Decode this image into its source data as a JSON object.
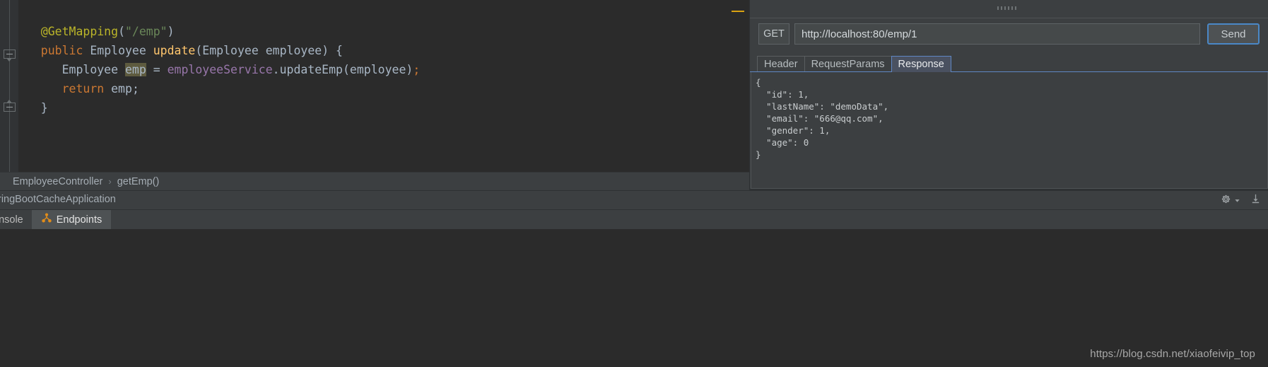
{
  "editor": {
    "code_lines": [
      {
        "indent": 3,
        "tokens": [
          {
            "t": "@GetMapping",
            "c": "tok-ann"
          },
          {
            "t": "(",
            "c": "tok-punct"
          },
          {
            "t": "\"/emp\"",
            "c": "tok-str"
          },
          {
            "t": ")",
            "c": "tok-punct"
          }
        ]
      },
      {
        "indent": 3,
        "tokens": [
          {
            "t": "public",
            "c": "tok-kw"
          },
          {
            "t": " ",
            "c": "tok-punct"
          },
          {
            "t": "Employee",
            "c": "tok-type"
          },
          {
            "t": " ",
            "c": "tok-punct"
          },
          {
            "t": "update",
            "c": "tok-meth"
          },
          {
            "t": "(",
            "c": "tok-punct"
          },
          {
            "t": "Employee",
            "c": "tok-type"
          },
          {
            "t": " employee",
            "c": "tok-ident"
          },
          {
            "t": ") {",
            "c": "tok-punct"
          }
        ]
      },
      {
        "indent": 6,
        "tokens": [
          {
            "t": "Employee",
            "c": "tok-type"
          },
          {
            "t": " ",
            "c": "tok-punct"
          },
          {
            "t": "emp",
            "c": "tok-hl"
          },
          {
            "t": " = ",
            "c": "tok-punct"
          },
          {
            "t": "employeeService",
            "c": "tok-field"
          },
          {
            "t": ".",
            "c": "tok-punct"
          },
          {
            "t": "updateEmp",
            "c": "tok-ident"
          },
          {
            "t": "(",
            "c": "tok-punct"
          },
          {
            "t": "employee",
            "c": "tok-ident"
          },
          {
            "t": ")",
            "c": "tok-punct"
          },
          {
            "t": ";",
            "c": "tok-kw"
          }
        ]
      },
      {
        "indent": 6,
        "tokens": [
          {
            "t": "return",
            "c": "tok-kw"
          },
          {
            "t": " emp",
            "c": "tok-ident"
          },
          {
            "t": ";",
            "c": "tok-punct"
          }
        ]
      },
      {
        "indent": 3,
        "tokens": [
          {
            "t": "}",
            "c": "tok-punct"
          }
        ]
      }
    ],
    "breadcrumb": {
      "class_name": "EmployeeController",
      "separator": "›",
      "method_name": "getEmp()"
    }
  },
  "run_bar": {
    "configuration_label": "ringBootCacheApplication"
  },
  "tool_window": {
    "tabs": [
      {
        "label": "onsole",
        "icon": "",
        "active": false
      },
      {
        "label": "Endpoints",
        "icon": "endpoints-icon",
        "active": true
      }
    ]
  },
  "console": {
    "watermark": "https://blog.csdn.net/xiaofeivip_top"
  },
  "http_client": {
    "method": "GET",
    "url": "http://localhost:80/emp/1",
    "url_placeholder": "http://localhost:80/emp/1",
    "send_label": "Send",
    "tabs": [
      {
        "label": "Header",
        "active": false
      },
      {
        "label": "RequestParams",
        "active": false
      },
      {
        "label": "Response",
        "active": true
      }
    ],
    "response_lines": [
      "{",
      "  \"id\": 1,",
      "  \"lastName\": \"demoData\",",
      "  \"email\": \"666@qq.com\",",
      "  \"gender\": 1,",
      "  \"age\": 0",
      "}"
    ]
  },
  "colors": {
    "editor_bg": "#2b2b2b",
    "panel_bg": "#3c3f41",
    "accent_blue": "#5f87c4",
    "accent_orange": "#e08c1a",
    "selection_highlight": "#5e5b3f",
    "scrollbar_mark": "#d9a212"
  }
}
